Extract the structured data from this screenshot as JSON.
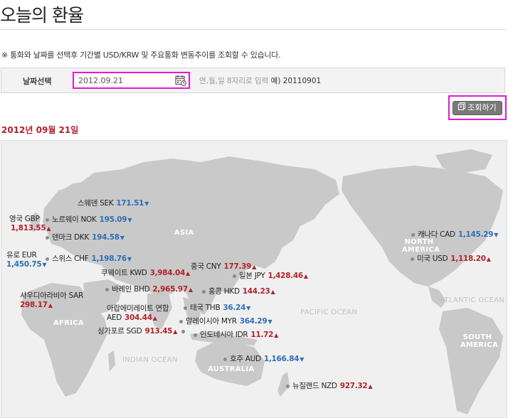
{
  "page": {
    "title": "오늘의 환율",
    "notice": "※ 통화와 날짜를 선택후 기간별 USD/KRW 및 주요통화 변동추이를 조회할 수 있습니다."
  },
  "search": {
    "label": "날짜선택",
    "date_value": "2012.09.21",
    "hint": "연,월,일 8자리로 입력",
    "example": "예) 20110901",
    "button_label": "조회하기"
  },
  "date_heading": "2012년 09월 21일",
  "map": {
    "regions": [
      "ASIA",
      "NORTH AMERICA",
      "AFRICA",
      "AUSTRALIA",
      "SOUTH AMERICA"
    ],
    "oceans": [
      "PACIFIC OCEAN",
      "ATLANTIC OCEAN",
      "INDIAN OCEAN"
    ]
  },
  "currencies": [
    {
      "name": "스웨덴 SEK",
      "rate": "171.51",
      "dir": "down"
    },
    {
      "name": "영국 GBP",
      "rate": "1,813.55",
      "dir": "up"
    },
    {
      "name": "노르웨이 NOK",
      "rate": "195.09",
      "dir": "down"
    },
    {
      "name": "덴마크 DKK",
      "rate": "194.58",
      "dir": "down"
    },
    {
      "name": "유로 EUR",
      "rate": "1,450.75",
      "dir": "down"
    },
    {
      "name": "스위스 CHF",
      "rate": "1,198.76",
      "dir": "down"
    },
    {
      "name": "쿠웨이트 KWD",
      "rate": "3,984.04",
      "dir": "up"
    },
    {
      "name": "바레인 BHD",
      "rate": "2,965.97",
      "dir": "up"
    },
    {
      "name": "사우디아라비아 SAR",
      "rate": "298.17",
      "dir": "up"
    },
    {
      "name": "아랍에미레이트 연합 AED",
      "rate": "304.44",
      "dir": "up"
    },
    {
      "name": "싱가포르 SGD",
      "rate": "913.45",
      "dir": "up"
    },
    {
      "name": "중국 CNY",
      "rate": "177.39",
      "dir": "up"
    },
    {
      "name": "일본 JPY",
      "rate": "1,428.46",
      "dir": "up"
    },
    {
      "name": "홍콩 HKD",
      "rate": "144.23",
      "dir": "up"
    },
    {
      "name": "태국 THB",
      "rate": "36.24",
      "dir": "down"
    },
    {
      "name": "말레이시아 MYR",
      "rate": "364.29",
      "dir": "down"
    },
    {
      "name": "인도네시아 IDR",
      "rate": "11.72",
      "dir": "up"
    },
    {
      "name": "호주 AUD",
      "rate": "1,166.84",
      "dir": "down"
    },
    {
      "name": "뉴질랜드 NZD",
      "rate": "927.32",
      "dir": "up"
    },
    {
      "name": "캐나다 CAD",
      "rate": "1,145.29",
      "dir": "down"
    },
    {
      "name": "미국 USD",
      "rate": "1,118.20",
      "dir": "up"
    }
  ],
  "colors": {
    "highlight_border": "#e21ad0",
    "up": "#b1242c",
    "down": "#2f6fb6",
    "map_land": "#c9c9c9",
    "map_bg": "#f0f0f0"
  },
  "icons": {
    "calendar": "calendar-icon",
    "search_button": "document-icon",
    "up": "triangle-up-icon",
    "down": "triangle-down-icon"
  }
}
